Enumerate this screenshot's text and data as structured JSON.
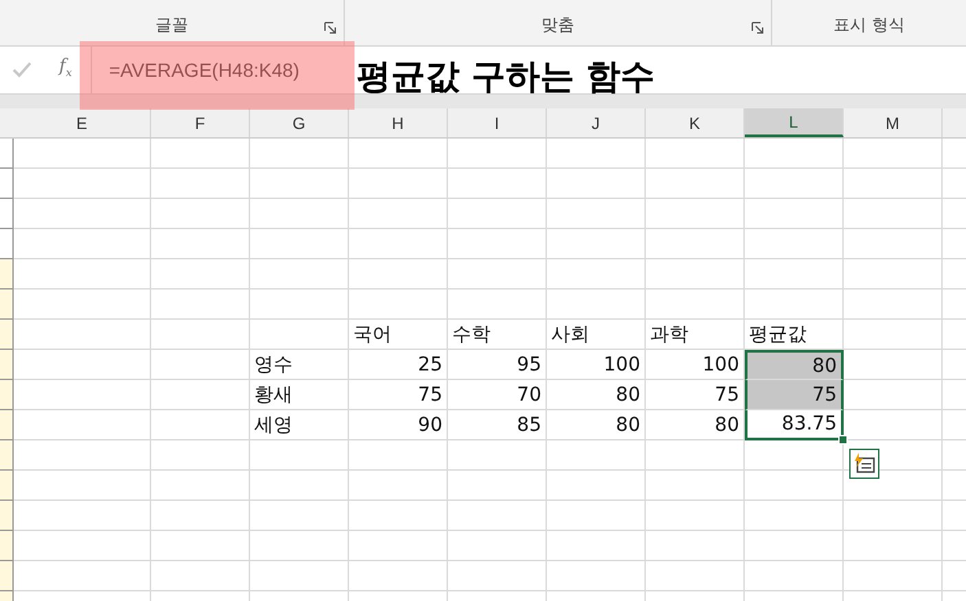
{
  "ribbon": {
    "groups": [
      {
        "label": "글꼴",
        "launcher": true
      },
      {
        "label": "맞춤",
        "launcher": true
      },
      {
        "label": "표시 형식",
        "launcher": false
      }
    ]
  },
  "formula_bar": {
    "function_button": "f$_{x}$",
    "value": "=AVERAGE(H48:K48)",
    "highlighted": true
  },
  "caption": "평균값 구하는 함수",
  "sheet": {
    "columns": [
      {
        "label": "E",
        "selected": false
      },
      {
        "label": "F",
        "selected": false
      },
      {
        "label": "G",
        "selected": false
      },
      {
        "label": "H",
        "selected": false
      },
      {
        "label": "I",
        "selected": false
      },
      {
        "label": "J",
        "selected": false
      },
      {
        "label": "K",
        "selected": false
      },
      {
        "label": "L",
        "selected": true
      },
      {
        "label": "M",
        "selected": false
      }
    ],
    "headers": [
      "국어",
      "수학",
      "사회",
      "과학",
      "평균값"
    ],
    "rows": [
      {
        "name": "영수",
        "values": [
          "25",
          "95",
          "100",
          "100"
        ],
        "average": "80",
        "selected": true,
        "active": false
      },
      {
        "name": "황새",
        "values": [
          "75",
          "70",
          "80",
          "75"
        ],
        "average": "75",
        "selected": true,
        "active": false
      },
      {
        "name": "세영",
        "values": [
          "90",
          "85",
          "80",
          "80"
        ],
        "average": "83.75",
        "selected": true,
        "active": true
      }
    ]
  }
}
